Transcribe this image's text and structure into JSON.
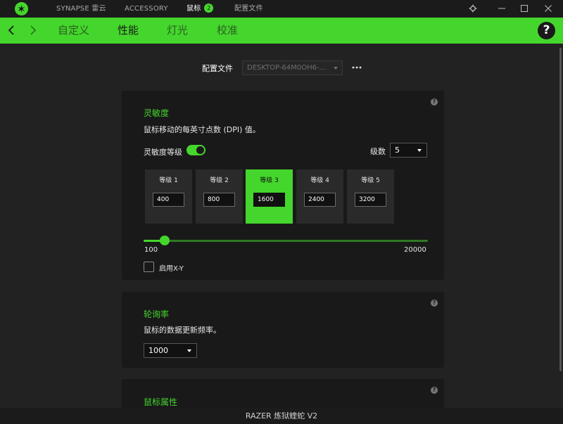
{
  "topbar": {
    "tabs": [
      {
        "label": "SYNAPSE 雷云"
      },
      {
        "label": "ACCESSORY"
      },
      {
        "label": "鼠标",
        "badge": "2"
      },
      {
        "label": "配置文件"
      }
    ],
    "active_tab": "鼠标",
    "window_controls": [
      "gear-icon",
      "minimize-icon",
      "maximize-icon",
      "close-icon"
    ]
  },
  "subnav": {
    "tabs": [
      {
        "label": "自定义"
      },
      {
        "label": "性能"
      },
      {
        "label": "灯光"
      },
      {
        "label": "校准"
      }
    ],
    "active_tab": "性能",
    "help_label": "?"
  },
  "profile": {
    "label": "配置文件",
    "value": "DESKTOP-64M0OH6-..."
  },
  "sensitivity": {
    "title": "灵敏度",
    "description": "鼠标移动的每英寸点数 (DPI) 值。",
    "stages_toggle_label": "灵敏度等级",
    "stages_enabled": true,
    "levels_label": "级数",
    "levels_value": "5",
    "stages": [
      {
        "label": "等级 1",
        "value": "400"
      },
      {
        "label": "等级 2",
        "value": "800"
      },
      {
        "label": "等级 3",
        "value": "1600"
      },
      {
        "label": "等级 4",
        "value": "2400"
      },
      {
        "label": "等级 5",
        "value": "3200"
      }
    ],
    "active_stage": 2,
    "slider": {
      "min": 100,
      "max": 20000,
      "value": 1600,
      "min_label": "100",
      "max_label": "20000"
    },
    "xy_label": "启用X-Y",
    "xy_enabled": false
  },
  "polling": {
    "title": "轮询率",
    "description": "鼠标的数据更新频率。",
    "value": "1000"
  },
  "mouse_props": {
    "title": "鼠标属性"
  },
  "device": {
    "name": "RAZER 炼狱蝰蛇 V2"
  },
  "colors": {
    "accent": "#44d62c",
    "background": "#222222",
    "panel": "#191919"
  }
}
